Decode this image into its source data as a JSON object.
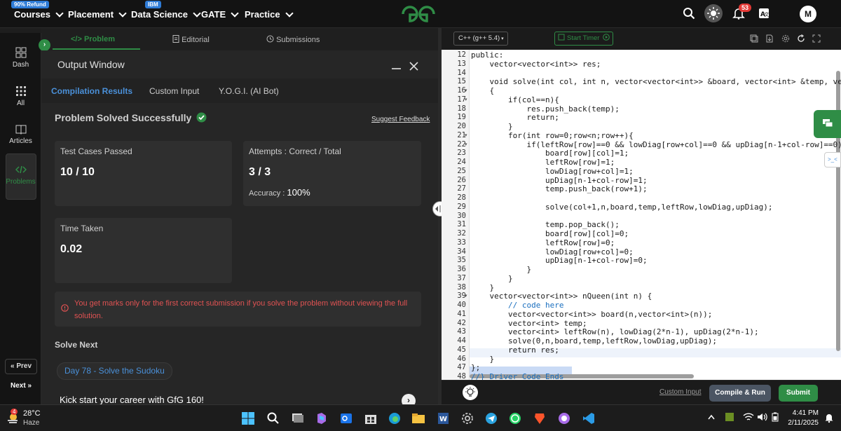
{
  "nav": {
    "courses_badge": "90% Refund",
    "courses": "Courses",
    "placement": "Placement",
    "datascience_badge": "IBM",
    "datascience": "Data Science",
    "gate": "GATE",
    "practice": "Practice",
    "notification_count": "53",
    "avatar": "M",
    "logo_icon": "gfg-logo-icon"
  },
  "sidebar": {
    "items": [
      {
        "label": "Dash",
        "icon": "dashboard-icon"
      },
      {
        "label": "All",
        "icon": "grid-icon"
      },
      {
        "label": "Articles",
        "icon": "book-icon"
      },
      {
        "label": "Problems",
        "icon": "code-icon"
      }
    ],
    "prev": "Prev",
    "next": "Next"
  },
  "tabs": {
    "problem": "Problem",
    "editorial": "Editorial",
    "submissions": "Submissions"
  },
  "output": {
    "title": "Output Window",
    "subtabs": [
      "Compilation Results",
      "Custom Input",
      "Y.O.G.I. (AI Bot)"
    ],
    "status": "Problem Solved Successfully",
    "feedback": "Suggest Feedback",
    "testcases_label": "Test Cases Passed",
    "testcases_value": "10 / 10",
    "attempts_label": "Attempts : Correct / Total",
    "attempts_value": "3 / 3",
    "accuracy_label": "Accuracy :",
    "accuracy_value": "100%",
    "time_label": "Time Taken",
    "time_value": "0.02",
    "warning": "You get marks only for the first correct submission if you solve the problem without viewing the full solution.",
    "solve_next": "Solve Next",
    "next_problem": "Day 78 - Solve the Sudoku",
    "promo": "Kick start your career with GfG 160!"
  },
  "editor": {
    "language": "C++ (g++ 5.4)",
    "timer": "Start Timer",
    "lines": [
      {
        "n": "12",
        "t": "public:"
      },
      {
        "n": "13",
        "t": "    vector<vector<int>> res;"
      },
      {
        "n": "14",
        "t": ""
      },
      {
        "n": "15",
        "t": "    void solve(int col, int n, vector<vector<int>> &board, vector<int> &temp, vector<i"
      },
      {
        "n": "16",
        "t": "    {"
      },
      {
        "n": "17",
        "t": "        if(col==n){"
      },
      {
        "n": "18",
        "t": "            res.push_back(temp);"
      },
      {
        "n": "19",
        "t": "            return;"
      },
      {
        "n": "20",
        "t": "        }"
      },
      {
        "n": "21",
        "t": "        for(int row=0;row<n;row++){"
      },
      {
        "n": "22",
        "t": "            if(leftRow[row]==0 && lowDiag[row+col]==0 && upDiag[n-1+col-row]==0){"
      },
      {
        "n": "23",
        "t": "                board[row][col]=1;"
      },
      {
        "n": "24",
        "t": "                leftRow[row]=1;"
      },
      {
        "n": "25",
        "t": "                lowDiag[row+col]=1;"
      },
      {
        "n": "26",
        "t": "                upDiag[n-1+col-row]=1;"
      },
      {
        "n": "27",
        "t": "                temp.push_back(row+1);"
      },
      {
        "n": "28",
        "t": ""
      },
      {
        "n": "29",
        "t": "                solve(col+1,n,board,temp,leftRow,lowDiag,upDiag);"
      },
      {
        "n": "30",
        "t": ""
      },
      {
        "n": "31",
        "t": "                temp.pop_back();"
      },
      {
        "n": "32",
        "t": "                board[row][col]=0;"
      },
      {
        "n": "33",
        "t": "                leftRow[row]=0;"
      },
      {
        "n": "34",
        "t": "                lowDiag[row+col]=0;"
      },
      {
        "n": "35",
        "t": "                upDiag[n-1+col-row]=0;"
      },
      {
        "n": "36",
        "t": "            }"
      },
      {
        "n": "37",
        "t": "        }"
      },
      {
        "n": "38",
        "t": "    }"
      },
      {
        "n": "39",
        "t": "    vector<vector<int>> nQueen(int n) {"
      },
      {
        "n": "40",
        "t": "        // code here"
      },
      {
        "n": "41",
        "t": "        vector<vector<int>> board(n,vector<int>(n));"
      },
      {
        "n": "42",
        "t": "        vector<int> temp;"
      },
      {
        "n": "43",
        "t": "        vector<int> leftRow(n), lowDiag(2*n-1), upDiag(2*n-1);"
      },
      {
        "n": "44",
        "t": "        solve(0,n,board,temp,leftRow,lowDiag,upDiag);"
      },
      {
        "n": "45",
        "t": "        return res;"
      },
      {
        "n": "46",
        "t": "    }"
      },
      {
        "n": "47",
        "t": "};"
      },
      {
        "n": "48",
        "t": "//} Driver Code Ends"
      }
    ],
    "custom_input": "Custom Input",
    "compile_run": "Compile & Run",
    "submit": "Submit"
  },
  "taskbar": {
    "temp": "28°C",
    "weather": "Haze",
    "weather_badge": "4",
    "time": "4:41 PM",
    "date": "2/11/2025"
  },
  "colors": {
    "gfg_green": "#2f8d46",
    "accent_blue": "#4a90d9",
    "success": "#2f8d46",
    "warning_red": "#e05252"
  }
}
